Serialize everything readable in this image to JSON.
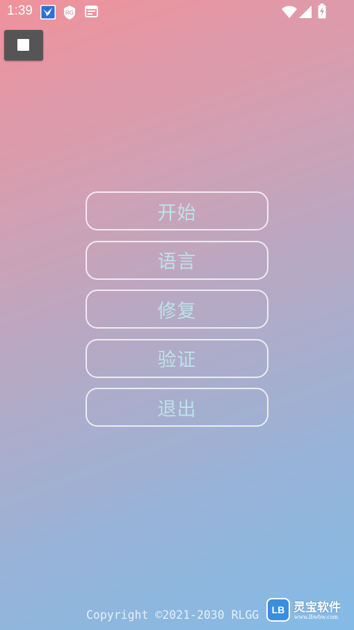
{
  "status_bar": {
    "time": "1:39",
    "icons_left": [
      "bird-app-icon",
      "shield-app-icon",
      "calendar-app-icon"
    ],
    "icons_right": [
      "wifi-icon",
      "signal-icon",
      "battery-charging-icon"
    ]
  },
  "corner_button": {
    "icon": "stop-square-icon"
  },
  "menu": {
    "items": [
      {
        "label": "开始"
      },
      {
        "label": "语言"
      },
      {
        "label": "修复"
      },
      {
        "label": "验证"
      },
      {
        "label": "退出"
      }
    ]
  },
  "footer": {
    "copyright": "Copyright ©2021-2030 RLGG"
  },
  "watermark": {
    "logo_text": "LB",
    "name": "灵宝软件",
    "url": "www.lbwbw.com"
  },
  "colors": {
    "gradient_top": "#f0929b",
    "gradient_bottom": "#83bbe6",
    "button_text": "#bde2ea",
    "button_border": "#ffffff",
    "corner_button_bg": "#555555"
  }
}
